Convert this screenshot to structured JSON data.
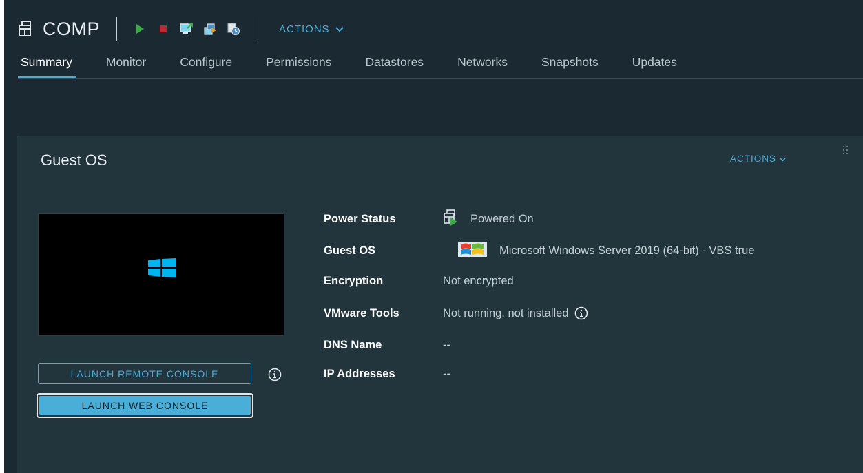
{
  "header": {
    "vm_name": "COMP",
    "actions_label": "ACTIONS",
    "toolbar_icons": [
      "power-on-icon",
      "power-off-icon",
      "launch-console-icon",
      "migrate-icon",
      "snapshot-icon"
    ]
  },
  "tabs": [
    {
      "label": "Summary",
      "active": true
    },
    {
      "label": "Monitor",
      "active": false
    },
    {
      "label": "Configure",
      "active": false
    },
    {
      "label": "Permissions",
      "active": false
    },
    {
      "label": "Datastores",
      "active": false
    },
    {
      "label": "Networks",
      "active": false
    },
    {
      "label": "Snapshots",
      "active": false
    },
    {
      "label": "Updates",
      "active": false
    }
  ],
  "card": {
    "title": "Guest OS",
    "actions_label": "ACTIONS",
    "launch_remote_label": "LAUNCH REMOTE CONSOLE",
    "launch_web_label": "LAUNCH WEB CONSOLE",
    "properties": {
      "power_status": {
        "label": "Power Status",
        "value": "Powered On"
      },
      "guest_os": {
        "label": "Guest OS",
        "value": "Microsoft Windows Server 2019 (64-bit) - VBS true"
      },
      "encryption": {
        "label": "Encryption",
        "value": "Not encrypted"
      },
      "vmware_tools": {
        "label": "VMware Tools",
        "value": "Not running, not installed"
      },
      "dns_name": {
        "label": "DNS Name",
        "value": "--"
      },
      "ip_addresses": {
        "label": "IP Addresses",
        "value": "--"
      }
    }
  },
  "colors": {
    "background": "#1b2a32",
    "card": "#22343c",
    "accent": "#49afd9",
    "power_on_green": "#3daa4a",
    "power_off_red": "#c2272d"
  }
}
